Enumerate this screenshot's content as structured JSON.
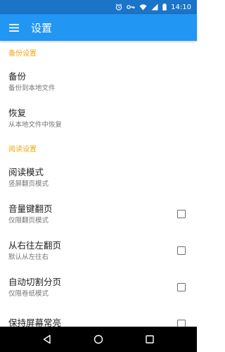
{
  "status_bar": {
    "time": "14:10",
    "icons": [
      "alarm-icon",
      "key-icon",
      "wifi-icon",
      "signal-icon",
      "battery-icon"
    ]
  },
  "app_bar": {
    "menu_icon": "menu-icon",
    "title": "设置"
  },
  "sections": {
    "backup": {
      "header": "备份设置",
      "items": [
        {
          "title": "备份",
          "summary": "备份到本地文件"
        },
        {
          "title": "恢复",
          "summary": "从本地文件中恢复"
        }
      ]
    },
    "reading": {
      "header": "阅读设置",
      "items": [
        {
          "title": "阅读模式",
          "summary": "竖屏翻页模式"
        },
        {
          "title": "音量键翻页",
          "summary": "仅限翻页模式",
          "checked": false
        },
        {
          "title": "从右往左翻页",
          "summary": "默认从左往右",
          "checked": false
        },
        {
          "title": "自动切割分页",
          "summary": "仅限卷纸模式",
          "checked": false
        },
        {
          "title": "保持屏幕常亮",
          "summary": "",
          "checked": false
        }
      ]
    }
  },
  "nav_bar": {
    "icons": [
      "back-icon",
      "home-icon",
      "recents-icon"
    ]
  },
  "colors": {
    "status_bar": "#1a74c8",
    "app_bar": "#2196f3",
    "section_header": "#f0a80f",
    "nav_bar": "#000000"
  }
}
